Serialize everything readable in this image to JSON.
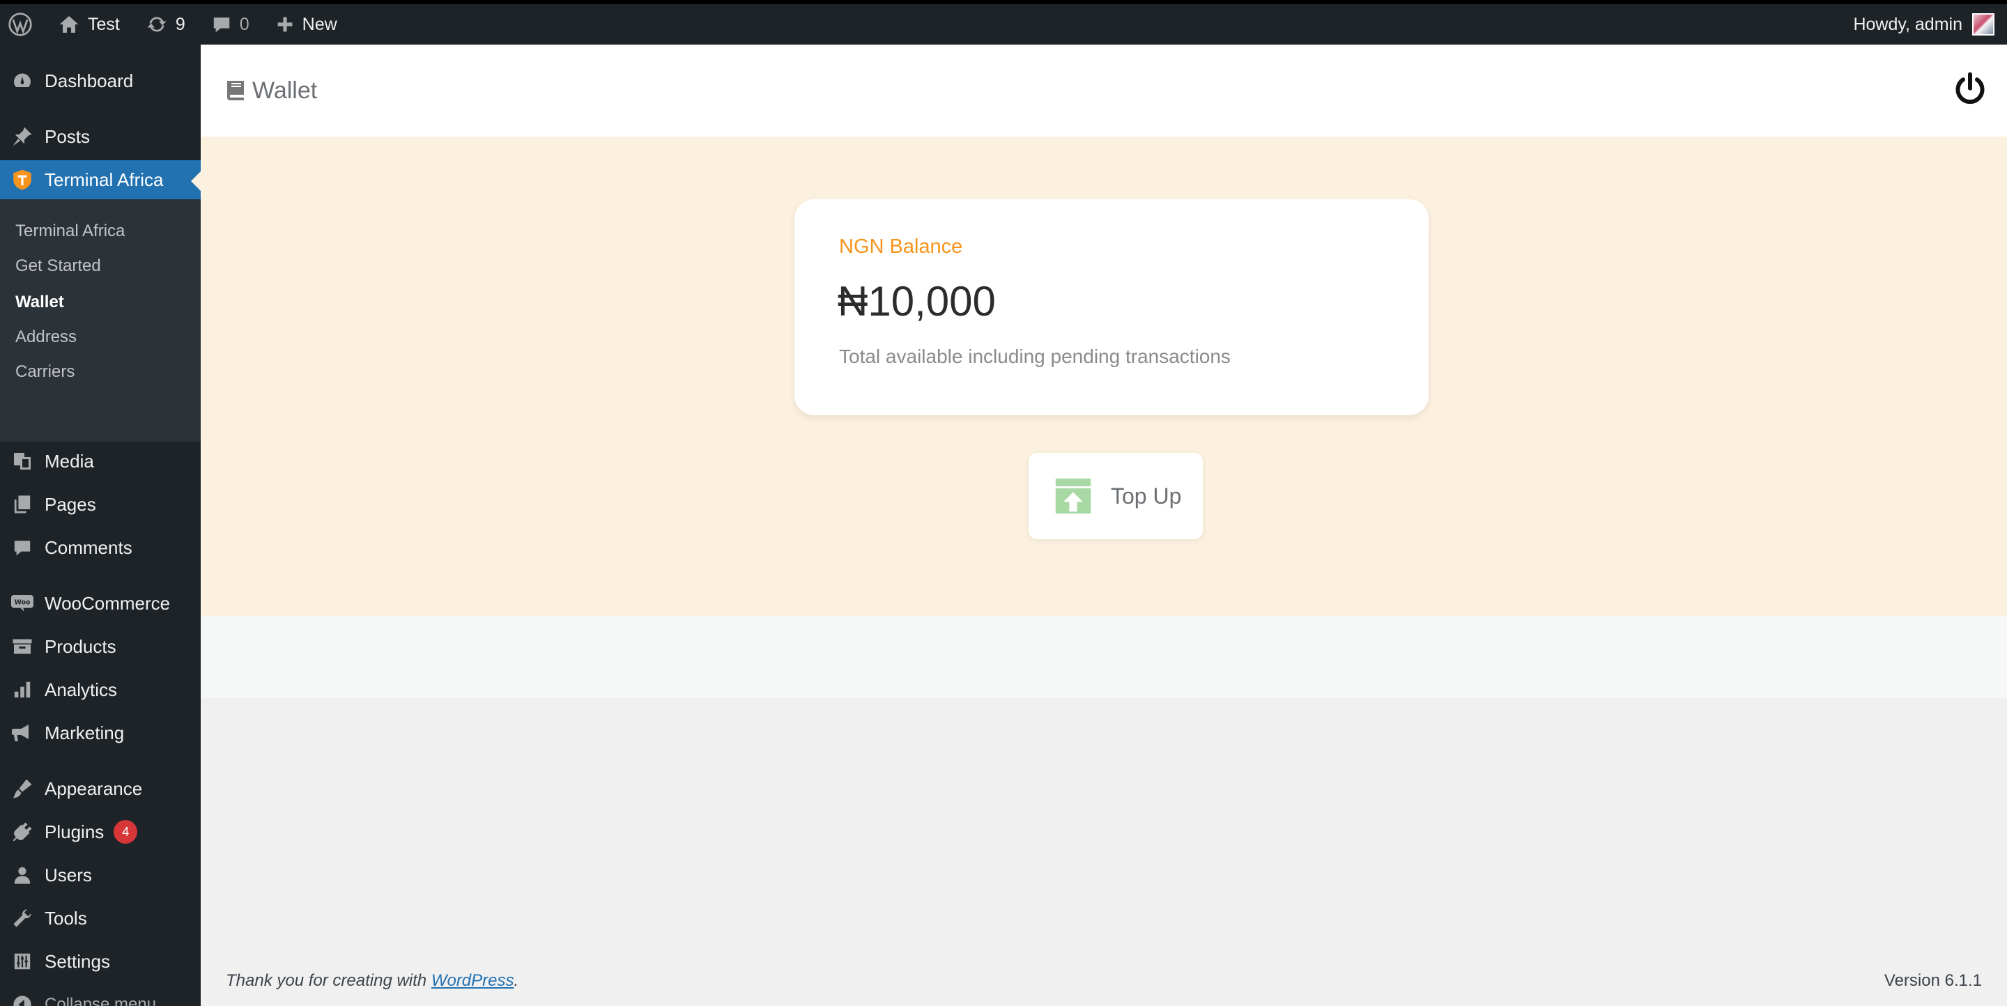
{
  "adminbar": {
    "site_name": "Test",
    "updates_count": "9",
    "comments_count": "0",
    "new_label": "New",
    "greeting": "Howdy, admin"
  },
  "sidebar": {
    "items": [
      {
        "label": "Dashboard",
        "icon": "dashboard-icon"
      },
      {
        "label": "Posts",
        "icon": "pin-icon"
      },
      {
        "label": "Terminal Africa",
        "icon": "terminal-africa-logo-icon"
      },
      {
        "label": "Media",
        "icon": "media-icon"
      },
      {
        "label": "Pages",
        "icon": "pages-icon"
      },
      {
        "label": "Comments",
        "icon": "comment-icon"
      },
      {
        "label": "WooCommerce",
        "icon": "woo-icon"
      },
      {
        "label": "Products",
        "icon": "archive-icon"
      },
      {
        "label": "Analytics",
        "icon": "bar-chart-icon"
      },
      {
        "label": "Marketing",
        "icon": "megaphone-icon"
      },
      {
        "label": "Appearance",
        "icon": "brush-icon"
      },
      {
        "label": "Plugins",
        "icon": "plug-icon",
        "badge": "4"
      },
      {
        "label": "Users",
        "icon": "user-icon"
      },
      {
        "label": "Tools",
        "icon": "wrench-icon"
      },
      {
        "label": "Settings",
        "icon": "sliders-icon"
      }
    ],
    "submenu": [
      "Terminal Africa",
      "Get Started",
      "Wallet",
      "Address",
      "Carriers"
    ],
    "collapse_label": "Collapse menu"
  },
  "page": {
    "title": "Wallet"
  },
  "balance_card": {
    "label": "NGN Balance",
    "amount": "₦10,000",
    "note": "Total available including pending transactions"
  },
  "topup": {
    "label": "Top Up"
  },
  "footer": {
    "thanks_prefix": "Thank you for creating with ",
    "wordpress_link": "WordPress",
    "thanks_suffix": ".",
    "version": "Version 6.1.1"
  },
  "colors": {
    "admin_dark": "#1d2327",
    "active_blue": "#2271b1",
    "hero_bg": "#fcf0df",
    "accent_orange": "#f7941d",
    "badge_red": "#d63638",
    "topup_green": "#a8d8a4"
  }
}
